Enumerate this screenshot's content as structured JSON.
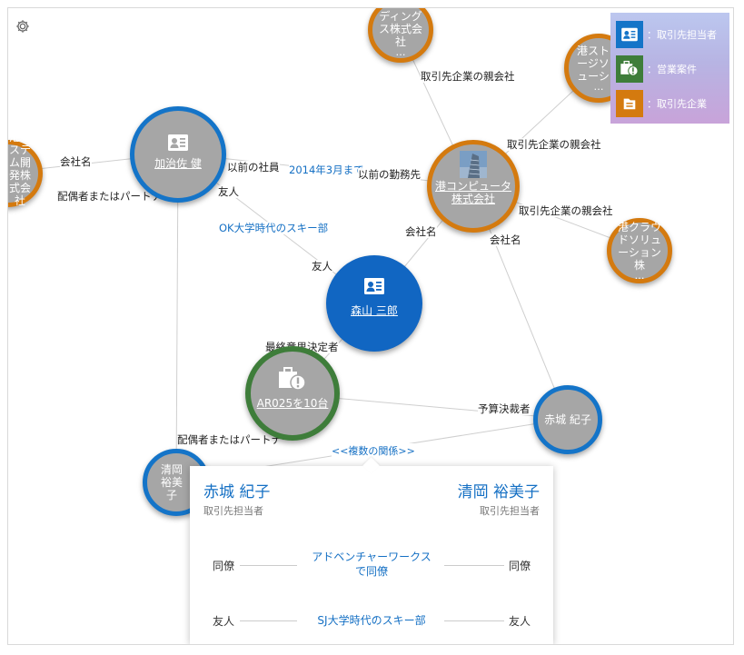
{
  "legend": {
    "items": [
      {
        "icon": "contact-card-icon",
        "color": "#1474c8",
        "label": "：取引先担当者"
      },
      {
        "icon": "opportunity-icon",
        "color": "#3e7d3a",
        "label": "：営業案件"
      },
      {
        "icon": "account-folder-icon",
        "color": "#d47a0f",
        "label": "：取引先企業"
      }
    ]
  },
  "nodes": {
    "top_holdings": {
      "label": "港ホールディングス株式会社",
      "ellipsis": "…"
    },
    "top_right_storage": {
      "label": "港ストレージソリューショ",
      "ellipsis": "…"
    },
    "left_systems": {
      "label": "港システム開発株式会社",
      "ellipsis": "…"
    },
    "kaji": {
      "label": "加治佐 健"
    },
    "computer": {
      "label": "港コンピュータ株式会社"
    },
    "cloud": {
      "label": "港クラウドソリューション株",
      "ellipsis": "…"
    },
    "moriyama": {
      "label": "森山 三郎"
    },
    "ar025": {
      "label": "AR025を10台"
    },
    "akagi": {
      "label": "赤城 紀子"
    },
    "kiyooka": {
      "label": "清岡 裕美子"
    }
  },
  "edge_labels": {
    "parent_company_1": "取引先企業の親会社",
    "parent_company_2": "取引先企業の親会社",
    "parent_company_3": "取引先企業の親会社",
    "company_name_left": "会社名",
    "spouse_1": "配偶者またはパートナー",
    "former_employee": "以前の社員",
    "until_date": "2014年3月まで",
    "former_employer": "以前の勤務先",
    "friend_1": "友人",
    "ok_ski": "OK大学時代のスキー部",
    "friend_2": "友人",
    "company_name_mid": "会社名",
    "company_name_right": "会社名",
    "final_decision": "最終意思決定者",
    "budget_decision": "予算決裁者",
    "spouse_2": "配偶者またはパートナー"
  },
  "multi_relationship": "<<複数の関係>>",
  "popup": {
    "left_name": "赤城 紀子",
    "left_role": "取引先担当者",
    "right_name": "清岡 裕美子",
    "right_role": "取引先担当者",
    "rows": [
      {
        "left": "同僚",
        "middle": "アドベンチャーワークスで同僚",
        "right": "同僚"
      },
      {
        "left": "友人",
        "middle": "SJ大学時代のスキー部",
        "right": "友人"
      }
    ]
  },
  "colors": {
    "account_border": "#d47a0f",
    "contact_border": "#1474c8",
    "opportunity_border": "#3e7d3a",
    "focus_fill": "#1166c2",
    "link_text": "#1570c4"
  }
}
